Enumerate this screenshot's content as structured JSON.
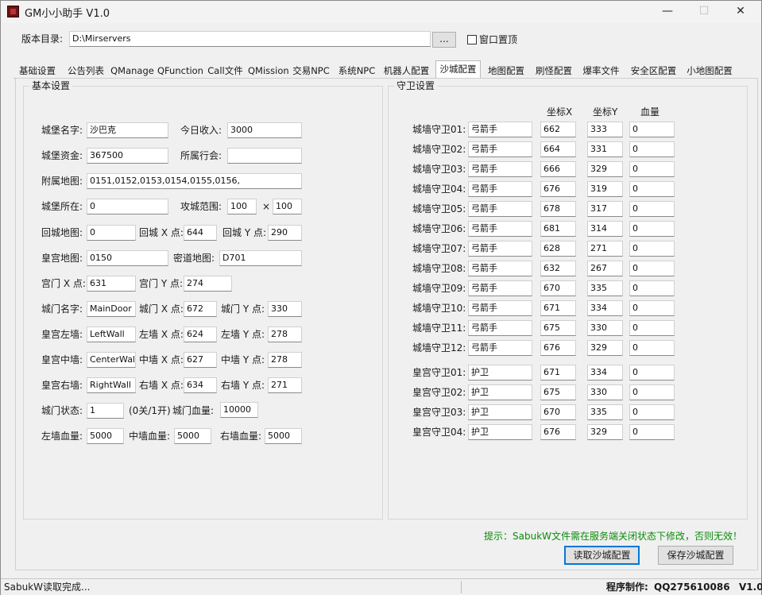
{
  "window": {
    "title": "GM小小助手 V1.0",
    "minimize": "—",
    "maximize": "☐",
    "close": "✕"
  },
  "top": {
    "dir_label": "版本目录:",
    "dir_value": "D:\\Mirservers",
    "browse_label": "...",
    "pin_label": "窗口置顶"
  },
  "tabs": [
    "基础设置",
    "公告列表",
    "QManage",
    "QFunction",
    "Call文件",
    "QMission",
    "交易NPC",
    "系统NPC",
    "机器人配置",
    "沙城配置",
    "地图配置",
    "刷怪配置",
    "爆率文件",
    "安全区配置",
    "小地图配置"
  ],
  "active_tab": 9,
  "basic": {
    "title": "基本设置",
    "castle_name_label": "城堡名字:",
    "castle_name": "沙巴克",
    "income_label": "今日收入:",
    "income": "3000",
    "funds_label": "城堡资金:",
    "funds": "367500",
    "guild_label": "所属行会:",
    "guild": "",
    "maps_label": "附属地图:",
    "maps": "0151,0152,0153,0154,0155,0156,",
    "location_label": "城堡所在:",
    "location": "0",
    "range_label": "攻城范围:",
    "range_x": "100",
    "range_sep": "×",
    "range_y": "100",
    "return_map_label": "回城地图:",
    "return_map": "0",
    "return_x_label": "回城 X 点:",
    "return_x": "644",
    "return_y_label": "回城 Y 点:",
    "return_y": "290",
    "palace_map_label": "皇宫地图:",
    "palace_map": "0150",
    "secret_map_label": "密道地图:",
    "secret_map": "D701",
    "gate_x_label": "宫门 X 点:",
    "gate_x": "631",
    "gate_y_label": "宫门 Y 点:",
    "gate_y": "274",
    "citygate_name_label": "城门名字:",
    "citygate_name": "MainDoor",
    "citygate_x_label": "城门 X 点:",
    "citygate_x": "672",
    "citygate_y_label": "城门 Y 点:",
    "citygate_y": "330",
    "leftwall_label": "皇宫左墙:",
    "leftwall": "LeftWall",
    "leftwall_x_label": "左墙 X 点:",
    "leftwall_x": "624",
    "leftwall_y_label": "左墙 Y 点:",
    "leftwall_y": "278",
    "centerwall_label": "皇宫中墙:",
    "centerwall": "CenterWall",
    "centerwall_x_label": "中墙 X 点:",
    "centerwall_x": "627",
    "centerwall_y_label": "中墙 Y 点:",
    "centerwall_y": "278",
    "rightwall_label": "皇宫右墙:",
    "rightwall": "RightWall",
    "rightwall_x_label": "右墙 X 点:",
    "rightwall_x": "634",
    "rightwall_y_label": "右墙 Y 点:",
    "rightwall_y": "271",
    "gate_state_label": "城门状态:",
    "gate_state": "1",
    "gate_state_hint": "(0关/1开)",
    "gate_hp_label": "城门血量:",
    "gate_hp": "10000",
    "leftwall_hp_label": "左墙血量:",
    "leftwall_hp": "5000",
    "centerwall_hp_label": "中墙血量:",
    "centerwall_hp": "5000",
    "rightwall_hp_label": "右墙血量:",
    "rightwall_hp": "5000"
  },
  "guards": {
    "title": "守卫设置",
    "col_x": "坐标X",
    "col_y": "坐标Y",
    "col_hp": "血量",
    "wall": [
      {
        "label": "城墙守卫01:",
        "type": "弓箭手",
        "x": "662",
        "y": "333",
        "hp": "0"
      },
      {
        "label": "城墙守卫02:",
        "type": "弓箭手",
        "x": "664",
        "y": "331",
        "hp": "0"
      },
      {
        "label": "城墙守卫03:",
        "type": "弓箭手",
        "x": "666",
        "y": "329",
        "hp": "0"
      },
      {
        "label": "城墙守卫04:",
        "type": "弓箭手",
        "x": "676",
        "y": "319",
        "hp": "0"
      },
      {
        "label": "城墙守卫05:",
        "type": "弓箭手",
        "x": "678",
        "y": "317",
        "hp": "0"
      },
      {
        "label": "城墙守卫06:",
        "type": "弓箭手",
        "x": "681",
        "y": "314",
        "hp": "0"
      },
      {
        "label": "城墙守卫07:",
        "type": "弓箭手",
        "x": "628",
        "y": "271",
        "hp": "0"
      },
      {
        "label": "城墙守卫08:",
        "type": "弓箭手",
        "x": "632",
        "y": "267",
        "hp": "0"
      },
      {
        "label": "城墙守卫09:",
        "type": "弓箭手",
        "x": "670",
        "y": "335",
        "hp": "0"
      },
      {
        "label": "城墙守卫10:",
        "type": "弓箭手",
        "x": "671",
        "y": "334",
        "hp": "0"
      },
      {
        "label": "城墙守卫11:",
        "type": "弓箭手",
        "x": "675",
        "y": "330",
        "hp": "0"
      },
      {
        "label": "城墙守卫12:",
        "type": "弓箭手",
        "x": "676",
        "y": "329",
        "hp": "0"
      }
    ],
    "palace": [
      {
        "label": "皇宫守卫01:",
        "type": "护卫",
        "x": "671",
        "y": "334",
        "hp": "0"
      },
      {
        "label": "皇宫守卫02:",
        "type": "护卫",
        "x": "675",
        "y": "330",
        "hp": "0"
      },
      {
        "label": "皇宫守卫03:",
        "type": "护卫",
        "x": "670",
        "y": "335",
        "hp": "0"
      },
      {
        "label": "皇宫守卫04:",
        "type": "护卫",
        "x": "676",
        "y": "329",
        "hp": "0"
      }
    ]
  },
  "footer": {
    "hint": "提示：SabukW文件需在服务端关闭状态下修改，否则无效！",
    "read_button": "读取沙城配置",
    "save_button": "保存沙城配置"
  },
  "status": {
    "left": "SabukW读取完成...",
    "author_label": "程序制作:",
    "author_value": "QQ275610086",
    "version": "V1.0"
  },
  "colors": {
    "hint_green": "#0a8c0a",
    "primary_border": "#0078d7"
  }
}
